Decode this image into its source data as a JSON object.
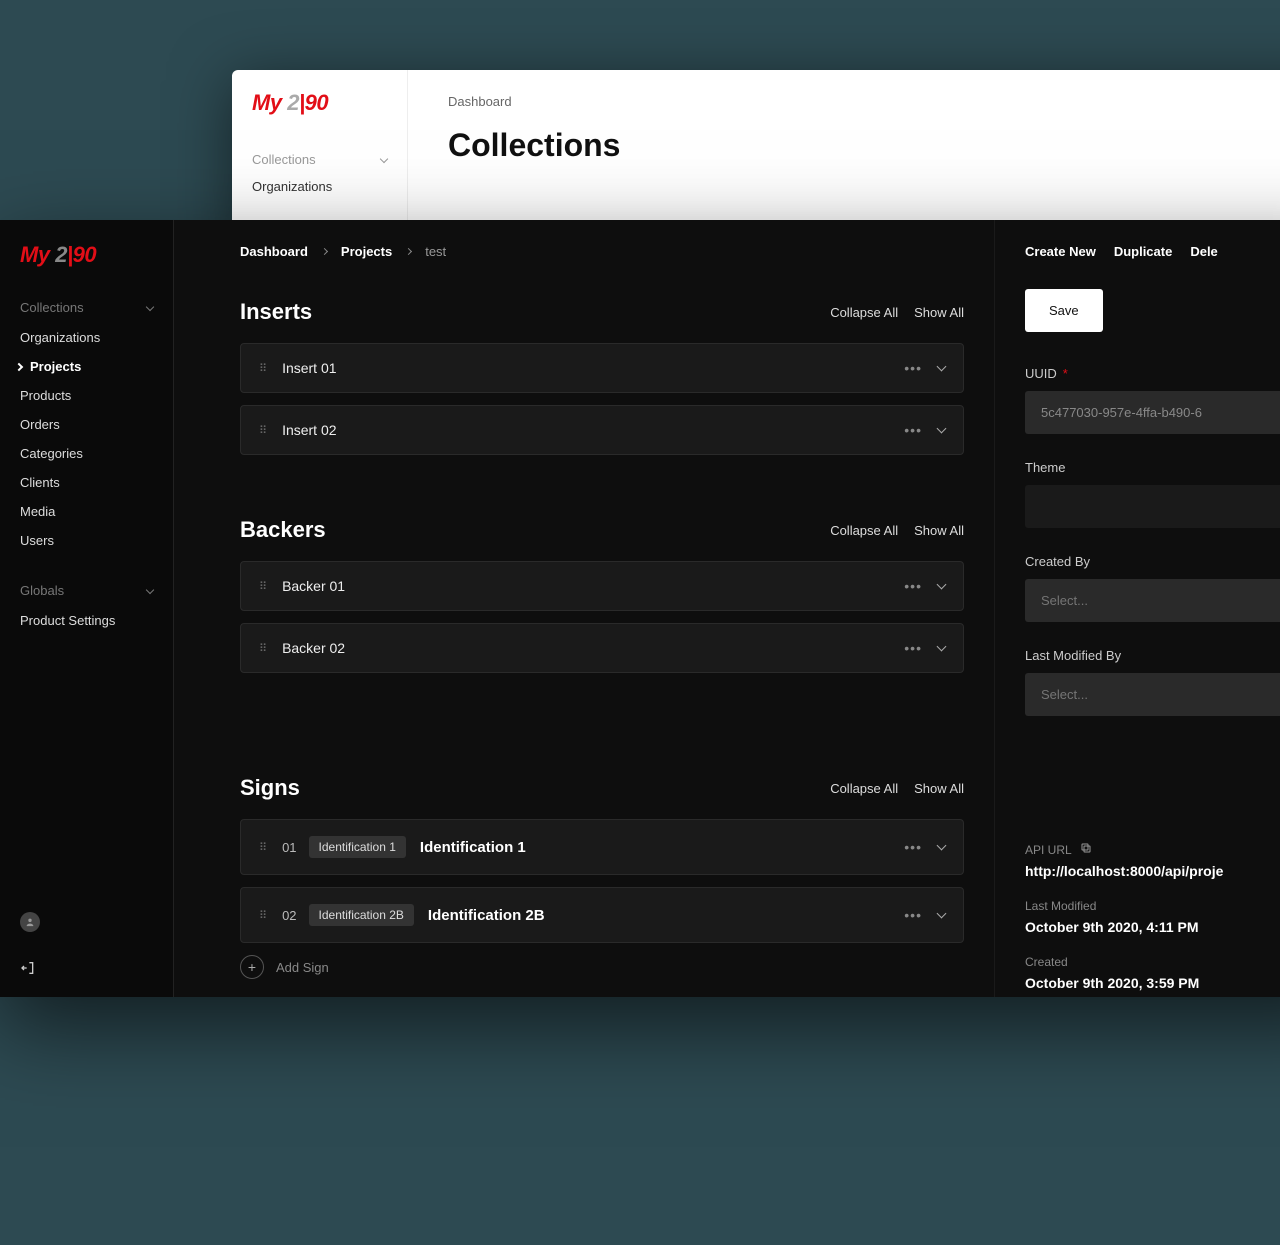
{
  "brand": {
    "prefix": "My ",
    "mid": "2",
    "bar": "|",
    "suffix": "90"
  },
  "light": {
    "nav": {
      "collections": "Collections",
      "organizations": "Organizations"
    },
    "crumb": "Dashboard",
    "title": "Collections"
  },
  "sidebar": {
    "collections_header": "Collections",
    "items": {
      "organizations": "Organizations",
      "projects": "Projects",
      "products": "Products",
      "orders": "Orders",
      "categories": "Categories",
      "clients": "Clients",
      "media": "Media",
      "users": "Users"
    },
    "globals_header": "Globals",
    "globals": {
      "product_settings": "Product Settings"
    }
  },
  "breadcrumb": {
    "dashboard": "Dashboard",
    "projects": "Projects",
    "current": "test"
  },
  "sections": {
    "inserts": {
      "title": "Inserts",
      "collapse": "Collapse All",
      "show": "Show All",
      "rows": [
        {
          "label": "Insert 01"
        },
        {
          "label": "Insert 02"
        }
      ]
    },
    "backers": {
      "title": "Backers",
      "collapse": "Collapse All",
      "show": "Show All",
      "rows": [
        {
          "label": "Backer 01"
        },
        {
          "label": "Backer 02"
        }
      ]
    },
    "signs": {
      "title": "Signs",
      "collapse": "Collapse All",
      "show": "Show All",
      "rows": [
        {
          "idx": "01",
          "chip": "Identification 1",
          "title": "Identification 1"
        },
        {
          "idx": "02",
          "chip": "Identification 2B",
          "title": "Identification 2B"
        }
      ],
      "add_label": "Add Sign"
    }
  },
  "detail": {
    "actions": {
      "create_new": "Create New",
      "duplicate": "Duplicate",
      "delete": "Dele"
    },
    "save": "Save",
    "fields": {
      "uuid_label": "UUID",
      "uuid_value": "5c477030-957e-4ffa-b490-6",
      "theme_label": "Theme",
      "theme_value": "",
      "created_by_label": "Created By",
      "created_by_placeholder": "Select...",
      "modified_by_label": "Last Modified By",
      "modified_by_placeholder": "Select..."
    },
    "meta": {
      "api_url_label": "API URL",
      "api_url_value": "http://localhost:8000/api/proje",
      "last_modified_label": "Last Modified",
      "last_modified_value": "October 9th 2020, 4:11 PM",
      "created_label": "Created",
      "created_value": "October 9th 2020, 3:59 PM"
    }
  }
}
